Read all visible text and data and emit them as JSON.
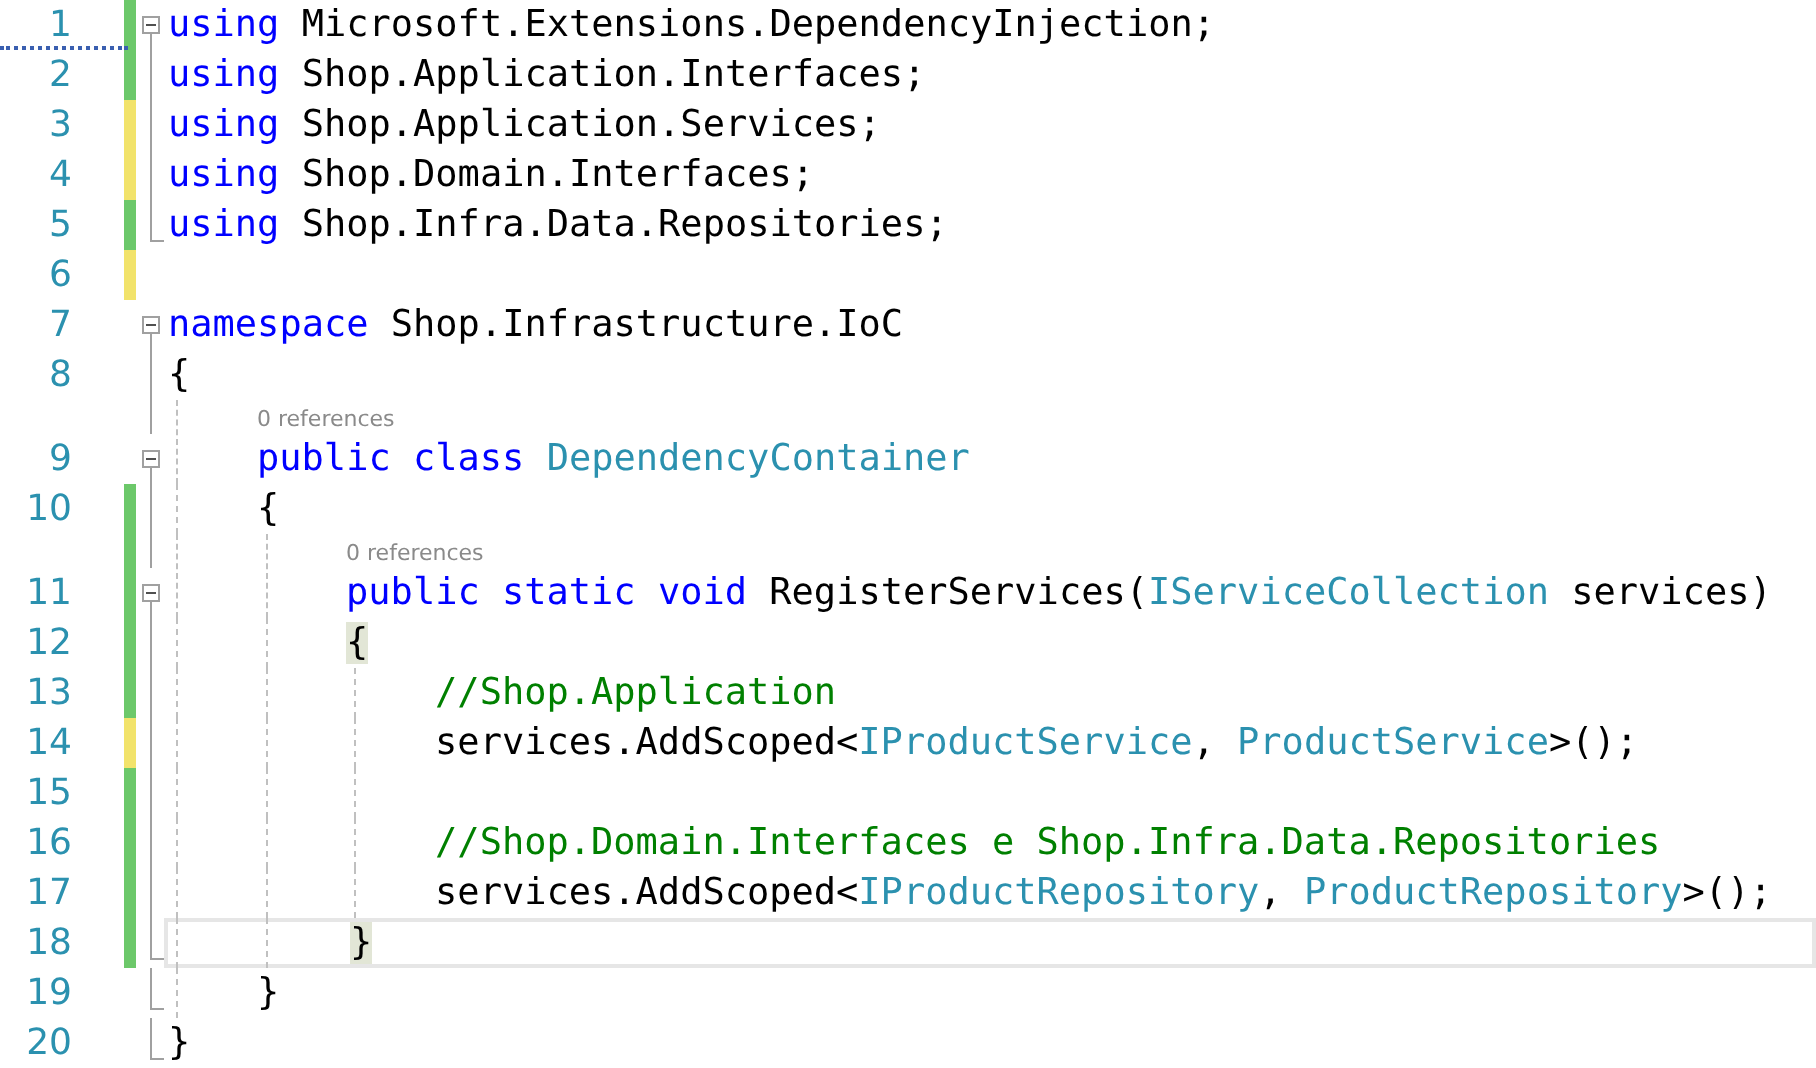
{
  "lines": [
    {
      "number": "1",
      "change": {
        "kind": "saved"
      },
      "fold": {
        "kind": "open"
      },
      "current": false,
      "tokens": [
        {
          "kind": "keyword",
          "text": "using"
        },
        {
          "kind": "plain",
          "text": " Microsoft.Extensions.DependencyInjection;"
        }
      ]
    },
    {
      "number": "2",
      "change": {
        "kind": "saved"
      },
      "fold": {
        "kind": "inside"
      },
      "current": false,
      "tokens": [
        {
          "kind": "keyword",
          "text": "using"
        },
        {
          "kind": "plain",
          "text": " Shop.Application.Interfaces;"
        }
      ]
    },
    {
      "number": "3",
      "change": {
        "kind": "unsaved"
      },
      "fold": {
        "kind": "inside"
      },
      "current": false,
      "tokens": [
        {
          "kind": "keyword",
          "text": "using"
        },
        {
          "kind": "plain",
          "text": " Shop.Application.Services;"
        }
      ]
    },
    {
      "number": "4",
      "change": {
        "kind": "unsaved"
      },
      "fold": {
        "kind": "inside"
      },
      "current": false,
      "tokens": [
        {
          "kind": "keyword",
          "text": "using"
        },
        {
          "kind": "plain",
          "text": " Shop.Domain.Interfaces;"
        }
      ]
    },
    {
      "number": "5",
      "change": {
        "kind": "saved"
      },
      "fold": {
        "kind": "end"
      },
      "current": false,
      "tokens": [
        {
          "kind": "keyword",
          "text": "using"
        },
        {
          "kind": "plain",
          "text": " Shop.Infra.Data.Repositories;"
        }
      ]
    },
    {
      "number": "6",
      "change": {
        "kind": "unsaved"
      },
      "current": false
    },
    {
      "number": "7",
      "fold": {
        "kind": "open"
      },
      "current": false,
      "tokens": [
        {
          "kind": "keyword",
          "text": "namespace"
        },
        {
          "kind": "plain",
          "text": " Shop.Infrastructure.IoC"
        }
      ]
    },
    {
      "number": "8",
      "fold": {
        "kind": "inside"
      },
      "current": false,
      "tokens": [
        {
          "kind": "plain",
          "text": "{"
        }
      ]
    },
    {
      "number": "9",
      "fold": {
        "kind": "open"
      },
      "current": false,
      "lens": "0 references",
      "tokens": [
        {
          "kind": "keyword",
          "text": "    public class "
        },
        {
          "kind": "type",
          "text": "DependencyContainer"
        }
      ]
    },
    {
      "number": "10",
      "change": {
        "kind": "saved"
      },
      "fold": {
        "kind": "inside"
      },
      "current": false,
      "tokens": [
        {
          "kind": "plain",
          "text": "    {"
        }
      ]
    },
    {
      "number": "11",
      "change": {
        "kind": "saved"
      },
      "fold": {
        "kind": "open"
      },
      "current": false,
      "lens": "0 references",
      "tokens": [
        {
          "kind": "keyword",
          "text": "        public static void"
        },
        {
          "kind": "plain",
          "text": " RegisterServices("
        },
        {
          "kind": "type",
          "text": "IServiceCollection"
        },
        {
          "kind": "plain",
          "text": " services)"
        }
      ]
    },
    {
      "number": "12",
      "change": {
        "kind": "saved"
      },
      "fold": {
        "kind": "inside"
      },
      "current": false,
      "tokens": [
        {
          "kind": "match",
          "text": "        {"
        }
      ]
    },
    {
      "number": "13",
      "change": {
        "kind": "saved"
      },
      "fold": {
        "kind": "inside"
      },
      "current": false,
      "tokens": [
        {
          "kind": "comment",
          "text": "            //Shop.Application"
        }
      ]
    },
    {
      "number": "14",
      "change": {
        "kind": "unsaved"
      },
      "fold": {
        "kind": "inside"
      },
      "current": false,
      "tokens": [
        {
          "kind": "plain",
          "text": "            services.AddScoped<"
        },
        {
          "kind": "type",
          "text": "IProductService"
        },
        {
          "kind": "plain",
          "text": ", "
        },
        {
          "kind": "type",
          "text": "ProductService"
        },
        {
          "kind": "plain",
          "text": ">();"
        }
      ]
    },
    {
      "number": "15",
      "change": {
        "kind": "saved"
      },
      "fold": {
        "kind": "inside"
      },
      "current": false
    },
    {
      "number": "16",
      "change": {
        "kind": "saved"
      },
      "fold": {
        "kind": "inside"
      },
      "current": false,
      "tokens": [
        {
          "kind": "comment",
          "text": "            //Shop.Domain.Interfaces e Shop.Infra.Data.Repositories"
        }
      ]
    },
    {
      "number": "17",
      "change": {
        "kind": "saved"
      },
      "fold": {
        "kind": "inside"
      },
      "current": false,
      "tokens": [
        {
          "kind": "plain",
          "text": "            services.AddScoped<"
        },
        {
          "kind": "type",
          "text": "IProductRepository"
        },
        {
          "kind": "plain",
          "text": ", "
        },
        {
          "kind": "type",
          "text": "ProductRepository"
        },
        {
          "kind": "plain",
          "text": ">();"
        }
      ]
    },
    {
      "number": "18",
      "change": {
        "kind": "saved"
      },
      "fold": {
        "kind": "end"
      },
      "current": true,
      "tokens": [
        {
          "kind": "match",
          "text": "        }"
        }
      ]
    },
    {
      "number": "19",
      "fold": {
        "kind": "end"
      },
      "current": false,
      "tokens": [
        {
          "kind": "plain",
          "text": "    }"
        }
      ]
    },
    {
      "number": "20",
      "fold": {
        "kind": "end"
      },
      "current": false,
      "tokens": [
        {
          "kind": "plain",
          "text": "}"
        }
      ]
    }
  ]
}
